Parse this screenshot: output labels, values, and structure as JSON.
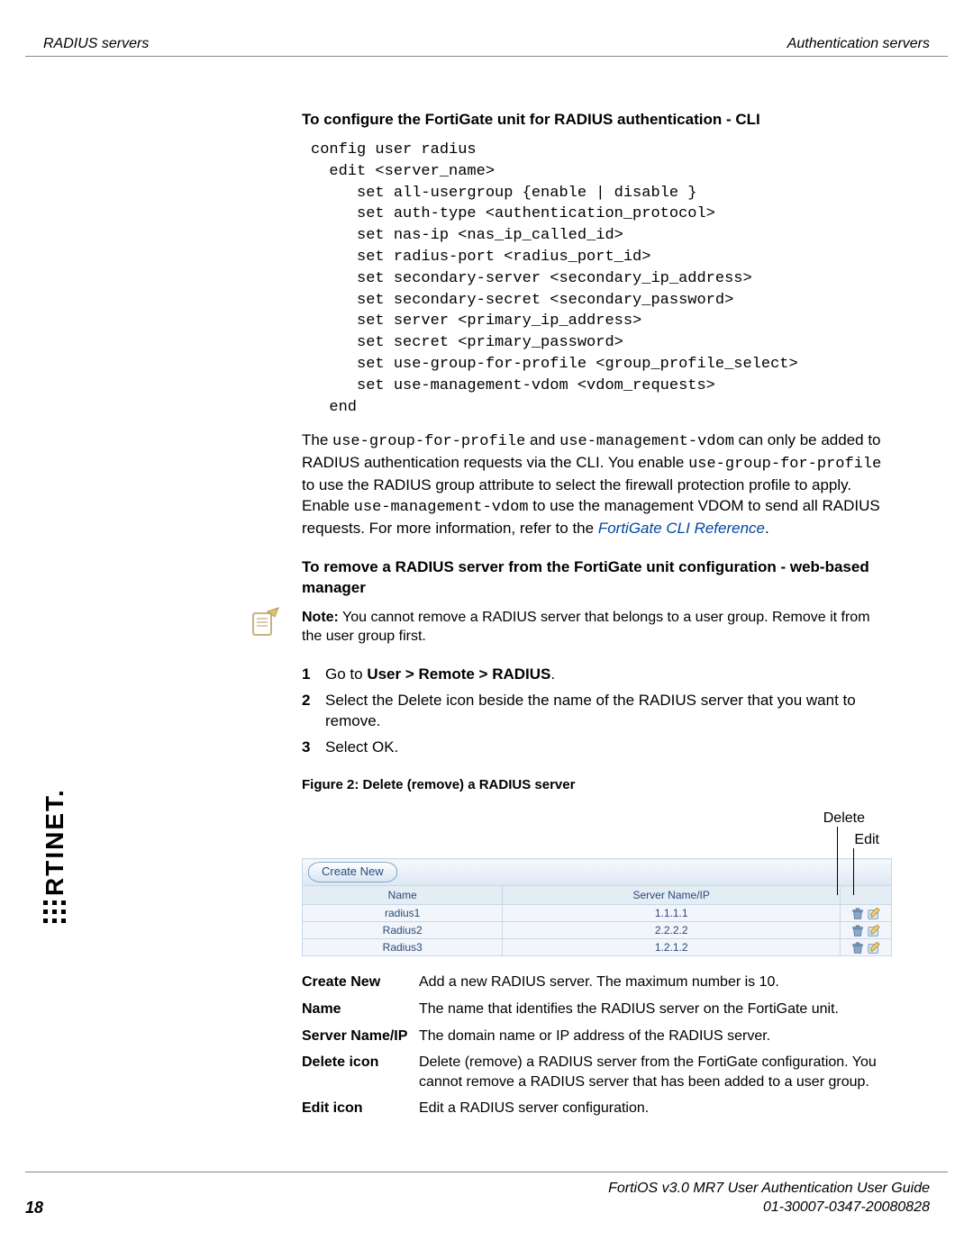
{
  "header": {
    "left": "RADIUS servers",
    "right": "Authentication servers"
  },
  "footer": {
    "page": "18",
    "guide": "FortiOS v3.0 MR7 User Authentication User Guide",
    "docid": "01-30007-0347-20080828"
  },
  "brand": "RTINET",
  "section1": {
    "heading": "To configure the FortiGate unit for RADIUS authentication - CLI",
    "cli": "config user radius\n  edit <server_name>\n     set all-usergroup {enable | disable }\n     set auth-type <authentication_protocol>\n     set nas-ip <nas_ip_called_id>\n     set radius-port <radius_port_id>\n     set secondary-server <secondary_ip_address>\n     set secondary-secret <secondary_password>\n     set server <primary_ip_address>\n     set secret <primary_password>\n     set use-group-for-profile <group_profile_select>\n     set use-management-vdom <vdom_requests>\n  end",
    "para_pre1": "The ",
    "mono1": "use-group-for-profile",
    "para_mid1": " and ",
    "mono2": "use-management-vdom",
    "para_post1": " can only be added to RADIUS authentication requests via the CLI. You enable ",
    "mono3": "use-group-for-profile",
    "para_post2": " to use the RADIUS group attribute to select the firewall protection profile to apply. Enable ",
    "mono4": "use-management-vdom",
    "para_post3": " to use the management VDOM to send all RADIUS requests. For more information, refer to the ",
    "link": "FortiGate CLI Reference",
    "para_end": "."
  },
  "section2": {
    "heading": "To remove a RADIUS server from the FortiGate unit configuration - web-based manager",
    "note_label": "Note:",
    "note_body": " You cannot remove a RADIUS server that belongs to a user group. Remove it from the user group first.",
    "steps": [
      {
        "num": "1",
        "pre": "Go to ",
        "bold": "User > Remote > RADIUS",
        "post": "."
      },
      {
        "num": "2",
        "pre": "Select the Delete icon beside the name of the RADIUS server that you want to remove.",
        "bold": "",
        "post": ""
      },
      {
        "num": "3",
        "pre": "Select OK.",
        "bold": "",
        "post": ""
      }
    ],
    "figcap": "Figure 2: Delete (remove) a RADIUS server",
    "callout_delete": "Delete",
    "callout_edit": "Edit",
    "ui": {
      "create_btn": "Create New",
      "col_name": "Name",
      "col_server": "Server Name/IP",
      "rows": [
        {
          "name": "radius1",
          "server": "1.1.1.1"
        },
        {
          "name": "Radius2",
          "server": "2.2.2.2"
        },
        {
          "name": "Radius3",
          "server": "1.2.1.2"
        }
      ]
    },
    "defs": [
      {
        "term": "Create New",
        "def": "Add a new RADIUS server. The maximum number is 10."
      },
      {
        "term": "Name",
        "def": "The name that identifies the RADIUS server on the FortiGate unit."
      },
      {
        "term": "Server Name/IP",
        "def": "The domain name or IP address of the RADIUS server."
      },
      {
        "term": "Delete icon",
        "def": "Delete (remove) a RADIUS server from the FortiGate configuration. You cannot remove a RADIUS server that has been added to a user group."
      },
      {
        "term": "Edit icon",
        "def": "Edit a RADIUS server configuration."
      }
    ]
  }
}
